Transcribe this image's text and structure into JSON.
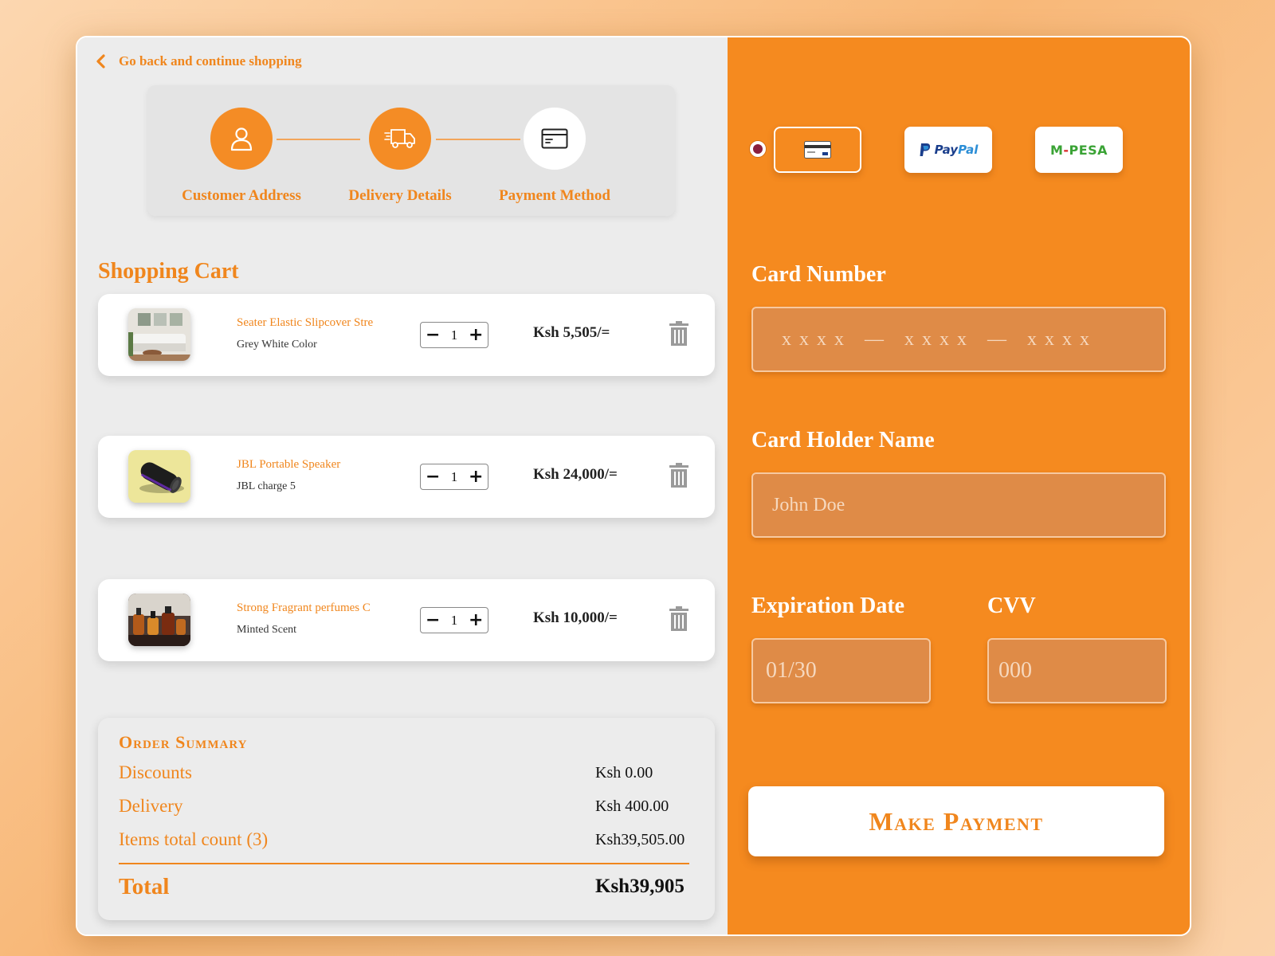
{
  "nav": {
    "back_label": "Go back and continue shopping",
    "back_icon": "chevron-left-icon"
  },
  "stepper": {
    "steps": [
      {
        "label": "Customer Address",
        "icon": "user-icon",
        "state": "complete"
      },
      {
        "label": "Delivery Details",
        "icon": "delivery-truck-icon",
        "state": "complete"
      },
      {
        "label": "Payment Method",
        "icon": "credit-card-icon",
        "state": "current"
      }
    ]
  },
  "cart": {
    "title": "Shopping Cart",
    "items": [
      {
        "name": "Seater Elastic Slipcover Stre",
        "variant": "Grey White Color",
        "quantity": "1",
        "price": "Ksh 5,505/="
      },
      {
        "name": "JBL Portable Speaker",
        "variant": "JBL charge 5",
        "quantity": "1",
        "price": "Ksh 24,000/="
      },
      {
        "name": "Strong Fragrant perfumes C",
        "variant": "Minted Scent",
        "quantity": "1",
        "price": "Ksh 10,000/="
      }
    ],
    "minus_label": "−",
    "plus_label": "+"
  },
  "summary": {
    "title": "Order Summary",
    "discounts_label": "Discounts",
    "discounts_value": "Ksh 0.00",
    "delivery_label": "Delivery",
    "delivery_value": "Ksh 400.00",
    "items_label": "Items total count (3)",
    "items_value": "Ksh39,505.00",
    "total_label": "Total",
    "total_value": "Ksh39,905"
  },
  "payment": {
    "options": [
      {
        "name": "card",
        "selected": true
      },
      {
        "name": "PayPal",
        "selected": false
      },
      {
        "name": "M-PESA",
        "selected": false
      }
    ],
    "paypal_p1": "Pay",
    "paypal_p2": "Pal",
    "mpesa_m": "M",
    "mpesa_dash": "-",
    "mpesa_rest": "PESA",
    "card_number_label": "Card Number",
    "card_number_placeholder": "x x x x   —   x x x x   —   x x x x",
    "holder_label": "Card Holder Name",
    "holder_placeholder": "John Doe",
    "expiry_label": "Expiration Date",
    "expiry_placeholder": "01/30",
    "cvv_label": "CVV",
    "cvv_placeholder": "000",
    "submit_label": "Make Payment"
  },
  "colors": {
    "accent": "#f58a1f",
    "panel_bg": "#ececec",
    "field_bg": "#df8b47",
    "radio_dot": "#8a1f3d"
  }
}
